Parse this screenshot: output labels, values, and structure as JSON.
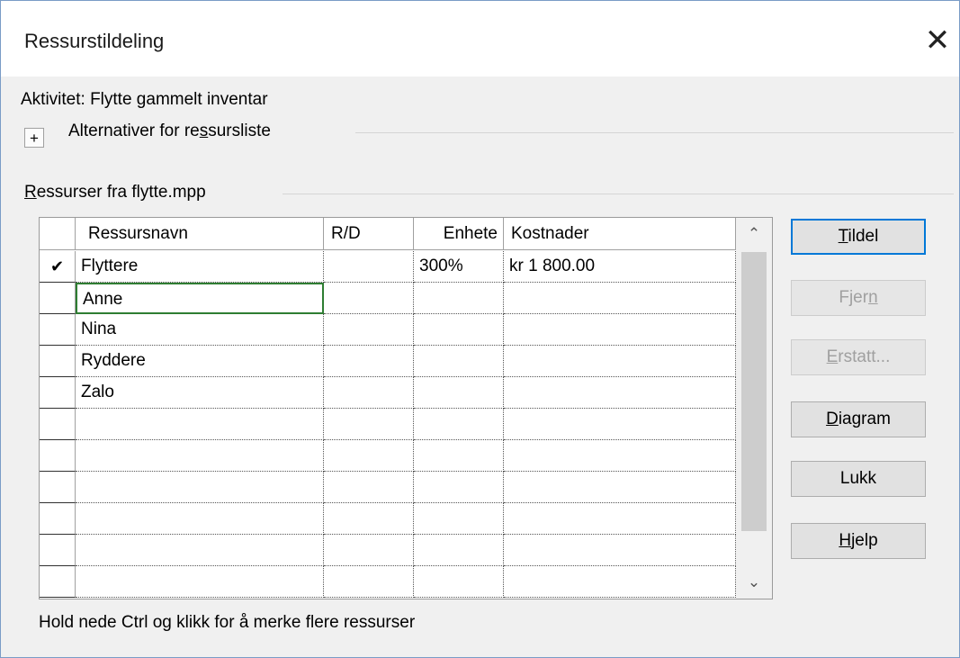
{
  "dialog": {
    "title": "Ressurstildeling",
    "close_glyph": "✕",
    "activity_label": "Aktivitet: Flytte gammelt inventar",
    "options": {
      "expand_glyph": "+",
      "label_pre": "Alternativer for re",
      "label_u": "s",
      "label_post": "sursliste"
    },
    "resources": {
      "label_u": "R",
      "label_post": "essurser fra flytte.mpp"
    },
    "columns": {
      "row_header": "",
      "name": "Ressursnavn",
      "rd": "R/D",
      "units": "Enhete",
      "cost": "Kostnader"
    },
    "rows": [
      {
        "check": "✔",
        "name": "Flyttere",
        "rd": "",
        "units": "300%",
        "cost": "kr 1 800.00"
      },
      {
        "check": "",
        "name": "Anne",
        "rd": "",
        "units": "",
        "cost": ""
      },
      {
        "check": "",
        "name": "Nina",
        "rd": "",
        "units": "",
        "cost": ""
      },
      {
        "check": "",
        "name": "Ryddere",
        "rd": "",
        "units": "",
        "cost": ""
      },
      {
        "check": "",
        "name": "Zalo",
        "rd": "",
        "units": "",
        "cost": ""
      },
      {
        "check": "",
        "name": "",
        "rd": "",
        "units": "",
        "cost": ""
      },
      {
        "check": "",
        "name": "",
        "rd": "",
        "units": "",
        "cost": ""
      },
      {
        "check": "",
        "name": "",
        "rd": "",
        "units": "",
        "cost": ""
      },
      {
        "check": "",
        "name": "",
        "rd": "",
        "units": "",
        "cost": ""
      },
      {
        "check": "",
        "name": "",
        "rd": "",
        "units": "",
        "cost": ""
      },
      {
        "check": "",
        "name": "",
        "rd": "",
        "units": "",
        "cost": ""
      }
    ],
    "selected_row": 1,
    "scrollbar": {
      "up_glyph": "⌃",
      "down_glyph": "⌄"
    },
    "buttons": {
      "assign": {
        "u": "T",
        "rest": "ildel"
      },
      "remove": {
        "pre": "Fjer",
        "u": "n",
        "rest": ""
      },
      "replace": {
        "u": "E",
        "rest": "rstatt..."
      },
      "graph": {
        "u": "D",
        "rest": "iagram"
      },
      "close": {
        "label": "Lukk"
      },
      "help": {
        "u": "H",
        "rest": "jelp"
      }
    },
    "hint": "Hold nede Ctrl og klikk for å merke flere ressurser"
  }
}
